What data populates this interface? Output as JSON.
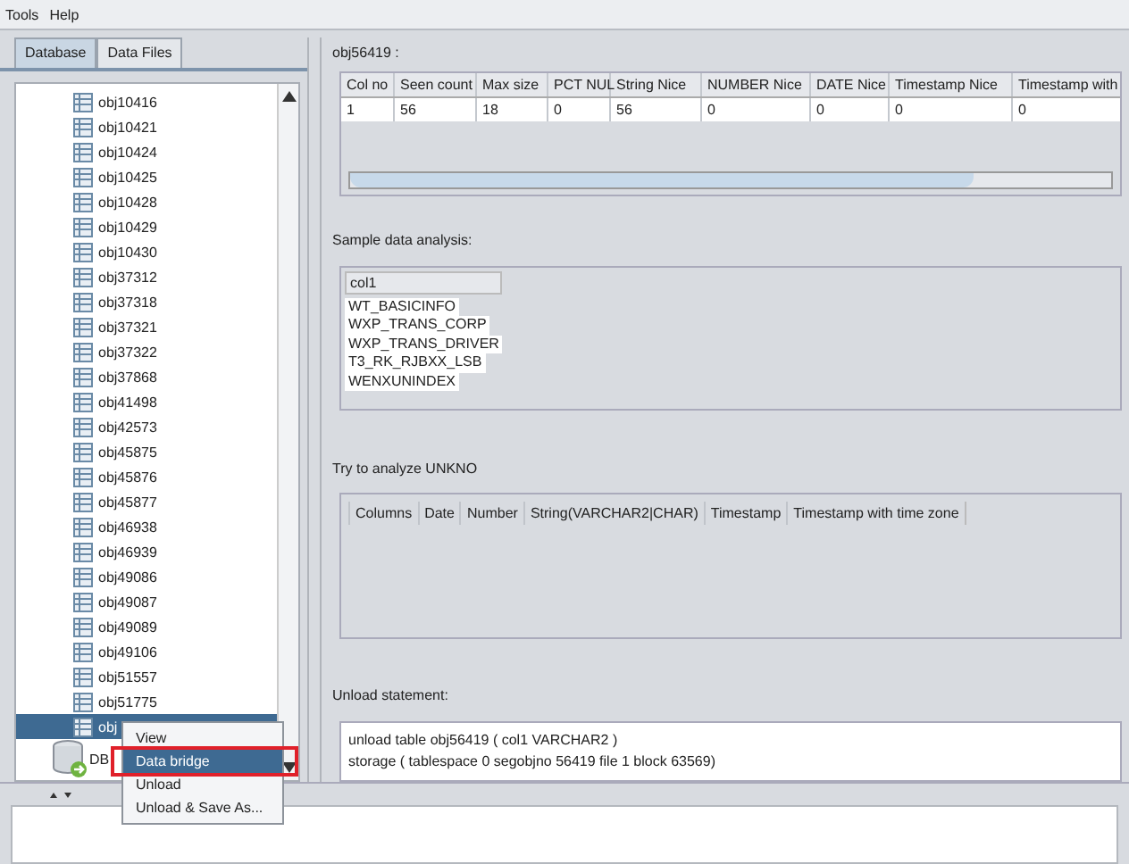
{
  "menu": [
    "Tools",
    "Help"
  ],
  "tabs": [
    {
      "label": "Database",
      "selected": true
    },
    {
      "label": "Data Files",
      "selected": false
    }
  ],
  "tree": {
    "items": [
      {
        "label": "obj10416",
        "kind": "table",
        "selected": false
      },
      {
        "label": "obj10421",
        "kind": "table",
        "selected": false
      },
      {
        "label": "obj10424",
        "kind": "table",
        "selected": false
      },
      {
        "label": "obj10425",
        "kind": "table",
        "selected": false
      },
      {
        "label": "obj10428",
        "kind": "table",
        "selected": false
      },
      {
        "label": "obj10429",
        "kind": "table",
        "selected": false
      },
      {
        "label": "obj10430",
        "kind": "table",
        "selected": false
      },
      {
        "label": "obj37312",
        "kind": "table",
        "selected": false
      },
      {
        "label": "obj37318",
        "kind": "table",
        "selected": false
      },
      {
        "label": "obj37321",
        "kind": "table",
        "selected": false
      },
      {
        "label": "obj37322",
        "kind": "table",
        "selected": false
      },
      {
        "label": "obj37868",
        "kind": "table",
        "selected": false
      },
      {
        "label": "obj41498",
        "kind": "table",
        "selected": false
      },
      {
        "label": "obj42573",
        "kind": "table",
        "selected": false
      },
      {
        "label": "obj45875",
        "kind": "table",
        "selected": false
      },
      {
        "label": "obj45876",
        "kind": "table",
        "selected": false
      },
      {
        "label": "obj45877",
        "kind": "table",
        "selected": false
      },
      {
        "label": "obj46938",
        "kind": "table",
        "selected": false
      },
      {
        "label": "obj46939",
        "kind": "table",
        "selected": false
      },
      {
        "label": "obj49086",
        "kind": "table",
        "selected": false
      },
      {
        "label": "obj49087",
        "kind": "table",
        "selected": false
      },
      {
        "label": "obj49089",
        "kind": "table",
        "selected": false
      },
      {
        "label": "obj49106",
        "kind": "table",
        "selected": false
      },
      {
        "label": "obj51557",
        "kind": "table",
        "selected": false
      },
      {
        "label": "obj51775",
        "kind": "table",
        "selected": false
      },
      {
        "label": "obj",
        "kind": "table",
        "selected": true
      },
      {
        "label": "DB",
        "kind": "database",
        "selected": false
      }
    ]
  },
  "context_menu": {
    "items": [
      {
        "label": "View",
        "selected": false,
        "annotated": false
      },
      {
        "label": "Data bridge",
        "selected": true,
        "annotated": true
      },
      {
        "label": "Unload",
        "selected": false,
        "annotated": false
      },
      {
        "label": "Unload & Save As...",
        "selected": false,
        "annotated": false
      }
    ]
  },
  "object_title": "obj56419 :",
  "column_table": {
    "columns": [
      "Col no",
      "Seen count",
      "Max size",
      "PCT NUL",
      "String Nice",
      "NUMBER Nice",
      "DATE Nice",
      "Timestamp Nice",
      "Timestamp with"
    ],
    "rows": [
      [
        "1",
        "56",
        "18",
        "0",
        "56",
        "0",
        "0",
        "0",
        "0"
      ]
    ]
  },
  "sample": {
    "label": "Sample data analysis:",
    "column": "col1",
    "values": [
      "WT_BASICINFO",
      "WXP_TRANS_CORP",
      "WXP_TRANS_DRIVER",
      "T3_RK_RJBXX_LSB",
      "WENXUNINDEX"
    ]
  },
  "unknown": {
    "label": "Try to analyze UNKNO",
    "columns": [
      "Columns",
      "Date",
      "Number",
      "String(VARCHAR2|CHAR)",
      "Timestamp",
      "Timestamp with time zone"
    ]
  },
  "unload": {
    "label": "Unload statement:",
    "lines": [
      "unload table obj56419 ( col1 VARCHAR2 )",
      "storage ( tablespace 0 segobjno 56419 file 1 block 63569)"
    ]
  }
}
